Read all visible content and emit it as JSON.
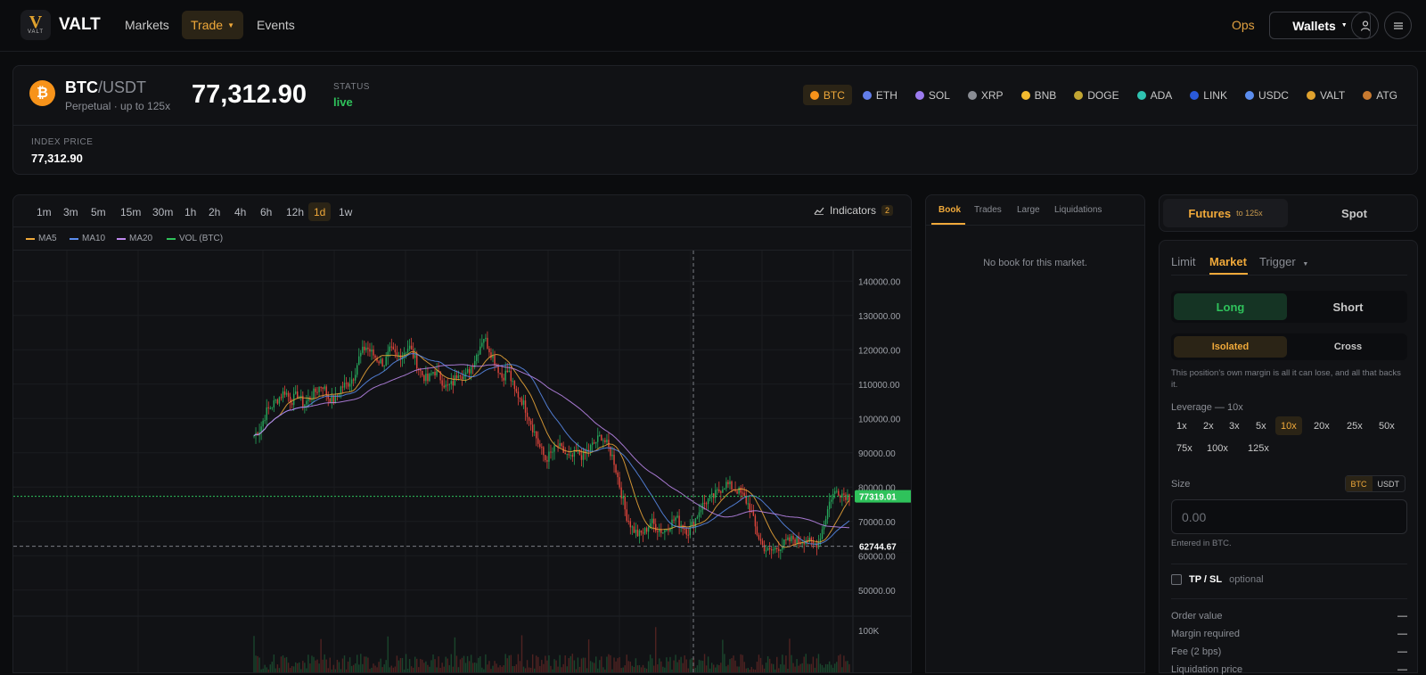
{
  "header": {
    "brand": "VALT",
    "logo_text": "VALT",
    "nav": [
      {
        "label": "Markets"
      },
      {
        "label": "Trade",
        "active": true
      },
      {
        "label": "Events"
      }
    ],
    "ops_label": "Ops",
    "wallets_label": "Wallets"
  },
  "market": {
    "base": "BTC",
    "quote": "/USDT",
    "subtitle": "Perpetual · up to 125x",
    "price": "77,312.90",
    "status_label": "STATUS",
    "status_value": "live",
    "index_label": "INDEX PRICE",
    "index_value": "77,312.90",
    "coins": [
      {
        "symbol": "BTC",
        "color": "#f7931a",
        "active": true
      },
      {
        "symbol": "ETH",
        "color": "#627eea"
      },
      {
        "symbol": "SOL",
        "color": "#9c7bf0"
      },
      {
        "symbol": "XRP",
        "color": "#8a8d94"
      },
      {
        "symbol": "BNB",
        "color": "#f3ba2f"
      },
      {
        "symbol": "DOGE",
        "color": "#c2a633"
      },
      {
        "symbol": "ADA",
        "color": "#2fc2b0"
      },
      {
        "symbol": "LINK",
        "color": "#2a5ada"
      },
      {
        "symbol": "USDC",
        "color": "#5b8def"
      },
      {
        "symbol": "VALT",
        "color": "#e0a22e"
      },
      {
        "symbol": "ATG",
        "color": "#c87a30"
      }
    ]
  },
  "chart": {
    "timeframes": [
      "1m",
      "3m",
      "5m",
      "15m",
      "30m",
      "1h",
      "2h",
      "4h",
      "6h",
      "12h",
      "1d",
      "1w"
    ],
    "active_timeframe": "1d",
    "indicators_label": "Indicators",
    "indicators_count": "2",
    "legend": [
      {
        "name": "MA5",
        "color": "#f0a93a"
      },
      {
        "name": "MA10",
        "color": "#5b8def"
      },
      {
        "name": "MA20",
        "color": "#c08af0"
      },
      {
        "name": "VOL (BTC)",
        "color": "#2fc25b"
      }
    ],
    "current_price_tag": "77319.01",
    "crosshair_price_tag": "62744.67",
    "volume_tick": "100K"
  },
  "chart_data": {
    "type": "candlestick",
    "ylim": [
      45000,
      145000
    ],
    "y_ticks": [
      140000,
      130000,
      120000,
      110000,
      100000,
      90000,
      80000,
      70000,
      60000,
      50000
    ],
    "y_tick_labels": [
      "140000.00",
      "130000.00",
      "120000.00",
      "110000.00",
      "100000.00",
      "90000.00",
      "80000.00",
      "70000.00",
      "60000.00",
      "50000.00"
    ],
    "current_price": 77319.01,
    "crosshair_price": 62744.67,
    "close_path": [
      95000,
      97000,
      102000,
      104000,
      106000,
      108000,
      105000,
      107000,
      104000,
      106000,
      108000,
      110000,
      106000,
      105000,
      109000,
      110000,
      112000,
      118000,
      121000,
      119000,
      117000,
      116000,
      120000,
      118000,
      119000,
      121000,
      117000,
      113000,
      111000,
      114000,
      112000,
      109000,
      110000,
      114000,
      112000,
      115000,
      119000,
      124000,
      120000,
      116000,
      112000,
      114000,
      108000,
      106000,
      102000,
      97000,
      92000,
      88000,
      90000,
      92000,
      90000,
      88000,
      90000,
      89000,
      91000,
      93000,
      95000,
      92000,
      88000,
      80000,
      72000,
      68000,
      66000,
      67000,
      70000,
      68000,
      67000,
      69000,
      71000,
      69000,
      67000,
      70000,
      74000,
      76000,
      77000,
      79000,
      81000,
      80000,
      79000,
      77000,
      74000,
      67000,
      63000,
      61000,
      62000,
      63000,
      64000,
      65000,
      64000,
      65000,
      63000,
      64000,
      70000,
      77000,
      79000,
      78000,
      77319
    ]
  },
  "book": {
    "tabs": [
      "Book",
      "Trades",
      "Large",
      "Liquidations"
    ],
    "active_tab": "Book",
    "empty_text": "No book for this market."
  },
  "order": {
    "mode_futures": "Futures",
    "mode_futures_sub": "to 125x",
    "mode_spot": "Spot",
    "types": [
      "Limit",
      "Market",
      "Trigger"
    ],
    "active_type": "Market",
    "long_label": "Long",
    "short_label": "Short",
    "isolated_label": "Isolated",
    "cross_label": "Cross",
    "margin_note": "This position's own margin is all it can lose, and all that backs it.",
    "leverage_label": "Leverage — 10x",
    "leverages": [
      "1x",
      "2x",
      "3x",
      "5x",
      "10x",
      "20x",
      "25x",
      "50x",
      "75x",
      "100x",
      "125x"
    ],
    "active_leverage": "10x",
    "size_label": "Size",
    "size_units": [
      "BTC",
      "USDT"
    ],
    "size_placeholder": "0.00",
    "size_note": "Entered in BTC.",
    "tpsl_label": "TP / SL",
    "tpsl_optional": "optional",
    "summary": [
      {
        "label": "Order value",
        "value": "—"
      },
      {
        "label": "Margin required",
        "value": "—"
      },
      {
        "label": "Fee (2 bps)",
        "value": "—"
      },
      {
        "label": "Liquidation price",
        "value": "—"
      }
    ]
  }
}
